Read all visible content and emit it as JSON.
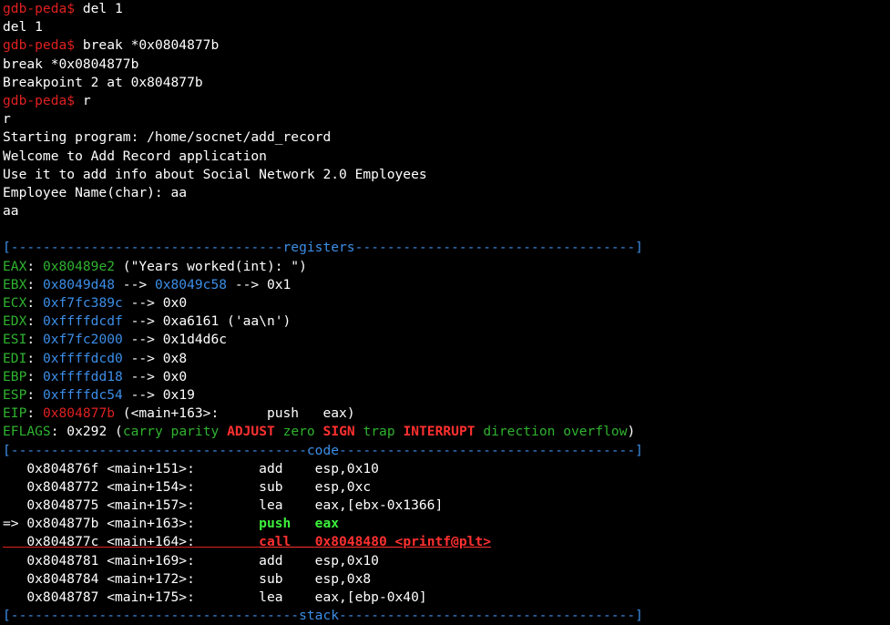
{
  "colors": {
    "background": "#000000",
    "text": "#ffffff",
    "prompt": "#e02020",
    "register_name": "#2fb32f",
    "address": "#3c8ee8",
    "section_rule": "#3c8ee8",
    "highlight_red": "#ff3030",
    "highlight_green": "#3cf03c"
  },
  "prompt": "gdb-peda$",
  "session": [
    {
      "cmd": " del 1",
      "echo": "del 1"
    },
    {
      "cmd": " break *0x0804877b",
      "echo": "break *0x0804877b"
    },
    {
      "output": "Breakpoint 2 at 0x804877b"
    },
    {
      "cmd": " r",
      "echo": "r"
    }
  ],
  "program_output": [
    "Starting program: /home/socnet/add_record",
    "Welcome to Add Record application",
    "Use it to add info about Social Network 2.0 Employees",
    "Employee Name(char): aa",
    "aa"
  ],
  "sections": {
    "registers": "[----------------------------------registers-----------------------------------]",
    "code": "[-------------------------------------code-------------------------------------]",
    "stack": "[------------------------------------stack-------------------------------------]"
  },
  "registers": {
    "eax": {
      "name": "EAX",
      "value": "0x80489e2",
      "rest": " (\"Years worked(int): \")"
    },
    "ebx": {
      "name": "EBX",
      "value": "0x8049d48",
      "arrow": " --> ",
      "value2": "0x8049c58",
      "rest": " --> 0x1"
    },
    "ecx": {
      "name": "ECX",
      "value": "0xf7fc389c",
      "rest": " --> 0x0"
    },
    "edx": {
      "name": "EDX",
      "value": "0xffffdcdf",
      "rest": " --> 0xa6161 ('aa\\n')"
    },
    "esi": {
      "name": "ESI",
      "value": "0xf7fc2000",
      "rest": " --> 0x1d4d6c"
    },
    "edi": {
      "name": "EDI",
      "value": "0xffffdcd0",
      "rest": " --> 0x8"
    },
    "ebp": {
      "name": "EBP",
      "value": "0xffffdd18",
      "rest": " --> 0x0"
    },
    "esp": {
      "name": "ESP",
      "value": "0xffffdc54",
      "rest": " --> 0x19"
    },
    "eip": {
      "name": "EIP",
      "value": "0x804877b",
      "rest": " (<main+163>:      push   eax)"
    },
    "eflags": {
      "name": "EFLAGS",
      "value": " 0x292 (",
      "carry": "carry",
      "parity": "parity",
      "adjust": "ADJUST",
      "zero": "zero",
      "sign": "SIGN",
      "trap": "trap",
      "interrupt": "INTERRUPT",
      "direction": "direction",
      "overflow": "overflow",
      "close": ")"
    }
  },
  "code": [
    {
      "text": "   0x804876f <main+151>:        add    esp,0x10"
    },
    {
      "text": "   0x8048772 <main+154>:        sub    esp,0xc"
    },
    {
      "text": "   0x8048775 <main+157>:        lea    eax,[ebx-0x1366]"
    },
    {
      "marker": "=> ",
      "addr": "0x804877b <main+163>:        ",
      "op": "push   eax"
    },
    {
      "pre": "   0x804877c <main+164>:",
      "gap": "        ",
      "mnem": "call   ",
      "target": "0x8048480 <printf@plt>"
    },
    {
      "text": "   0x8048781 <main+169>:        add    esp,0x10"
    },
    {
      "text": "   0x8048784 <main+172>:        sub    esp,0x8"
    },
    {
      "text": "   0x8048787 <main+175>:        lea    eax,[ebp-0x40]"
    }
  ]
}
